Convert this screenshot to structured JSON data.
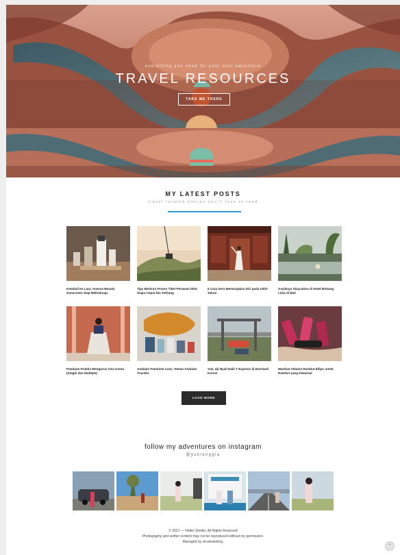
{
  "hero": {
    "kicker": "everything you need for your next adventure",
    "title": "TRAVEL RESOURCES",
    "cta_label": "TAKE ME THERE"
  },
  "latest_posts": {
    "title": "MY LATEST POSTS",
    "subtitle": "travel related stories you'll love to read",
    "accent_color": "#2c9bd1",
    "posts": [
      {
        "title": "Kembali ke Laut, Anessa Beauty Sunscreen Siap Melindungi"
      },
      {
        "title": "Tips Berburu Promo Tiket Pesawat 2020, Siapa Cepat Dia Terbang"
      },
      {
        "title": "6 Cara Seru Memanjakan Diri pada Akhir Tahun"
      },
      {
        "title": "Asyiknya Staycation di Hotel Bintang Lima di Bali"
      },
      {
        "title": "Panduan Praktis Mengurus Visa Korea (Single dan Multiple)"
      },
      {
        "title": "Andalan Feminine Care, Teman Andalan Traveler"
      },
      {
        "title": "Yuk, Uji Nyali Naik T Express di Everland Korea!"
      },
      {
        "title": "Manfaat Vitamin Rambut Ellips untuk Rambut yang Diwarnai"
      }
    ],
    "load_more_label": "LOAD MORE"
  },
  "instagram": {
    "title": "follow my adventures on instagram",
    "handle": "@yukianggia"
  },
  "footer": {
    "line1": "© 2021 — Helter Skelter. All Rights Reserved",
    "line2": "Photography and written content may not be reproduced without my permission.",
    "line3": "Managed by virustraveling."
  },
  "back_to_top": "⌃"
}
